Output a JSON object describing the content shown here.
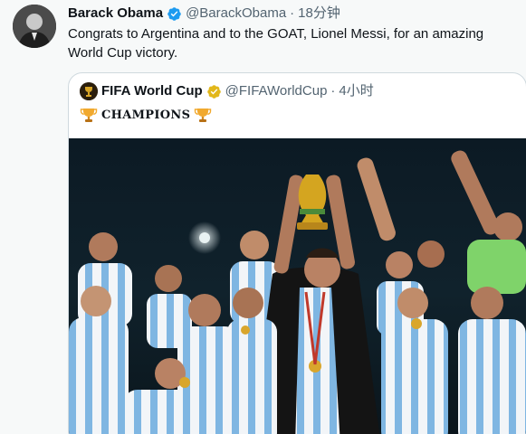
{
  "tweet": {
    "author_name": "Barack Obama",
    "author_handle": "@BarackObama",
    "separator": "·",
    "time": "18分钟",
    "text": "Congrats to Argentina and to the GOAT, Lionel Messi, for an amazing World Cup victory.",
    "verified_icon": "verified-badge-icon",
    "colors": {
      "verified_blue": "#1d9bf0",
      "secondary_text": "#536471"
    }
  },
  "quote": {
    "author_name": "FIFA World Cup",
    "author_handle": "@FIFAWorldCup",
    "separator": "·",
    "time": "4小时",
    "text": "CHAMPIONS",
    "leading_icon": "trophy-icon",
    "trailing_icon": "trophy-icon",
    "verified_icon": "gold-verified-badge-icon",
    "colors": {
      "verified_gold": "#e2b719",
      "border": "#cfd9de"
    },
    "media": {
      "type": "photo",
      "alt_icon": "team-celebration-photo"
    }
  }
}
